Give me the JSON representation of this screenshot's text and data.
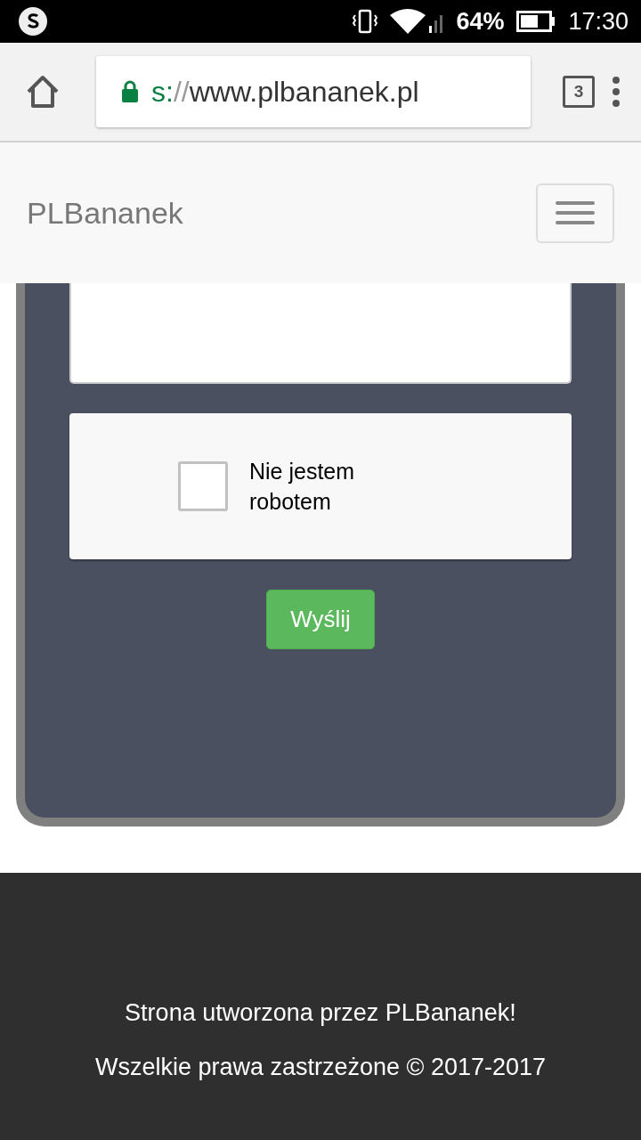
{
  "status_bar": {
    "battery_percent": "64%",
    "time": "17:30"
  },
  "browser": {
    "url": {
      "scheme": "s:",
      "separator": "//",
      "host": "www.plbananek.pl"
    },
    "tab_count": "3"
  },
  "navbar": {
    "brand": "PLBananek"
  },
  "form": {
    "captcha": {
      "label": "Nie jestem robotem",
      "checked": false
    },
    "submit": "Wyślij"
  },
  "footer": {
    "lines": [
      "Strona utworzona przez PLBananek!",
      "Wszelkie prawa zastrzeżone © 2017-2017"
    ]
  }
}
